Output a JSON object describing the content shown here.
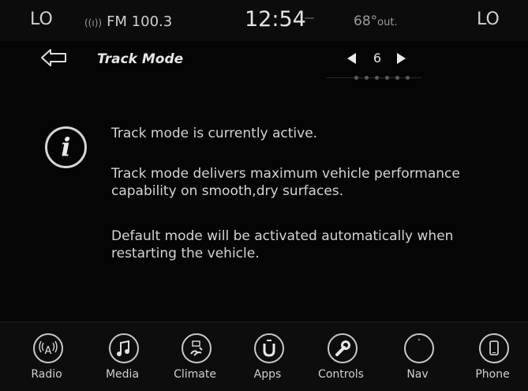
{
  "status": {
    "left_zone": "LO",
    "right_zone": "LO",
    "radio": "FM 100.3",
    "time": "12:54",
    "temp_value": "68°",
    "temp_suffix": "out."
  },
  "header": {
    "title": "Track Mode",
    "page_number": "6",
    "page_dots_count": 6
  },
  "message": {
    "line1": "Track mode is currently active.",
    "line2": "Track mode delivers maximum vehicle performance capability on smooth,dry surfaces.",
    "line3": "Default mode will be activated automatically when restarting the vehicle."
  },
  "nav": {
    "items": [
      {
        "label": "Radio",
        "icon": "radio-icon"
      },
      {
        "label": "Media",
        "icon": "music-note-icon"
      },
      {
        "label": "Climate",
        "icon": "climate-icon"
      },
      {
        "label": "Apps",
        "icon": "apps-icon"
      },
      {
        "label": "Controls",
        "icon": "wrench-icon"
      },
      {
        "label": "Nav",
        "icon": "compass-icon"
      },
      {
        "label": "Phone",
        "icon": "phone-icon"
      }
    ]
  },
  "colors": {
    "background": "#050505",
    "text": "#d4d4d4",
    "accent": "#eaeaea"
  }
}
